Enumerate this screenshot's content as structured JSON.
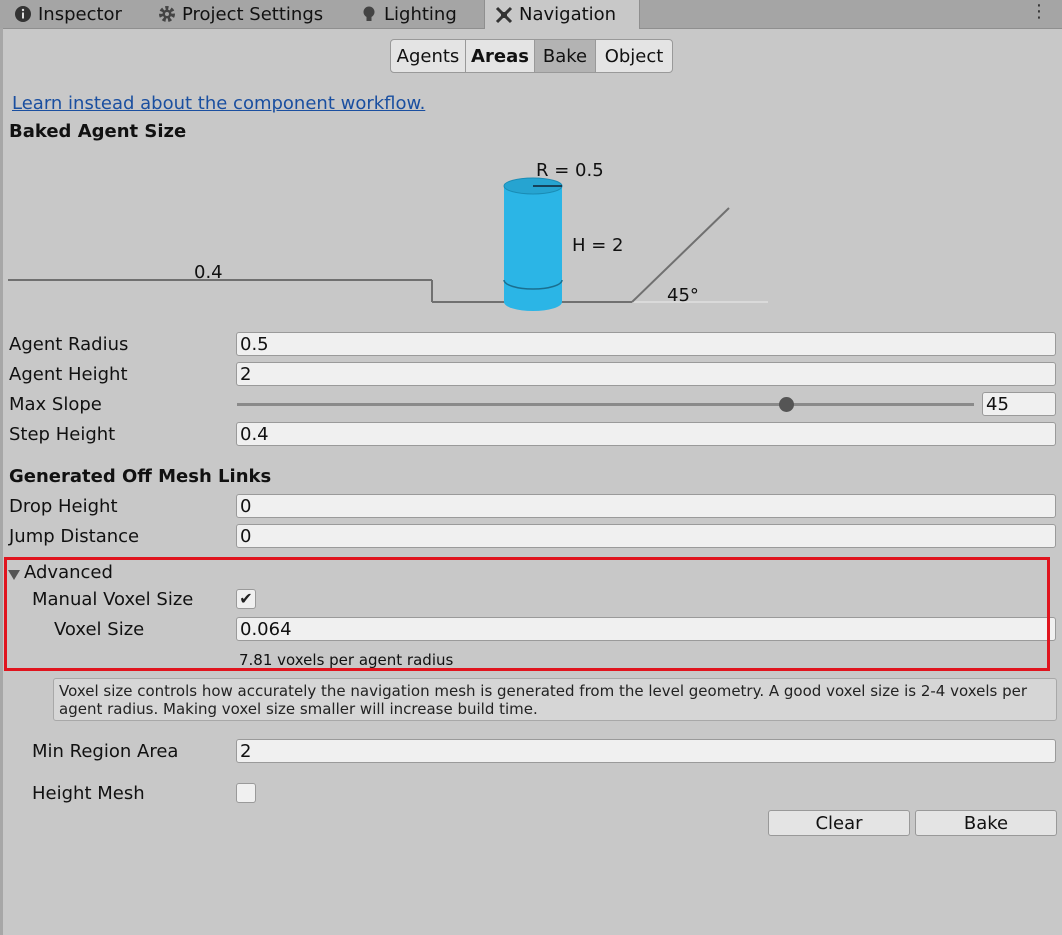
{
  "tabs": [
    {
      "label": "Inspector",
      "icon": "info-icon"
    },
    {
      "label": "Project Settings",
      "icon": "gear-icon"
    },
    {
      "label": "Lighting",
      "icon": "bulb-icon"
    },
    {
      "label": "Navigation",
      "icon": "navigation-icon",
      "active": true
    }
  ],
  "menu_glyph": "⋮",
  "segments": [
    "Agents",
    "Areas",
    "Bake",
    "Object"
  ],
  "selected_segment": "Bake",
  "link_text": "Learn instead about the component workflow.",
  "baked_agent_size": {
    "heading": "Baked Agent Size",
    "radius_label": "R = 0.5",
    "height_label": "H = 2",
    "step_label": "0.4",
    "slope_label": "45°",
    "accent_color": "#2bb5e6"
  },
  "fields": {
    "agent_radius": {
      "label": "Agent Radius",
      "value": "0.5"
    },
    "agent_height": {
      "label": "Agent Height",
      "value": "2"
    },
    "max_slope": {
      "label": "Max Slope",
      "value": "45",
      "slider_min": 0,
      "slider_max": 60
    },
    "step_height": {
      "label": "Step Height",
      "value": "0.4"
    }
  },
  "offmesh": {
    "heading": "Generated Off Mesh Links",
    "drop_height": {
      "label": "Drop Height",
      "value": "0"
    },
    "jump_distance": {
      "label": "Jump Distance",
      "value": "0"
    }
  },
  "advanced": {
    "foldout_label": "Advanced",
    "expanded": true,
    "manual_voxel_size": {
      "label": "Manual Voxel Size",
      "checked": true,
      "check_glyph": "✔"
    },
    "voxel_size": {
      "label": "Voxel Size",
      "value": "0.064"
    },
    "voxel_info": "7.81 voxels per agent radius",
    "highlight_color": "#e0141e"
  },
  "help_text": "Voxel size controls how accurately the navigation mesh is generated from the level geometry. A good voxel size is 2-4 voxels per agent radius. Making voxel size smaller will increase build time.",
  "min_region_area": {
    "label": "Min Region Area",
    "value": "2"
  },
  "height_mesh": {
    "label": "Height Mesh",
    "checked": false
  },
  "buttons": {
    "clear": "Clear",
    "bake": "Bake"
  }
}
